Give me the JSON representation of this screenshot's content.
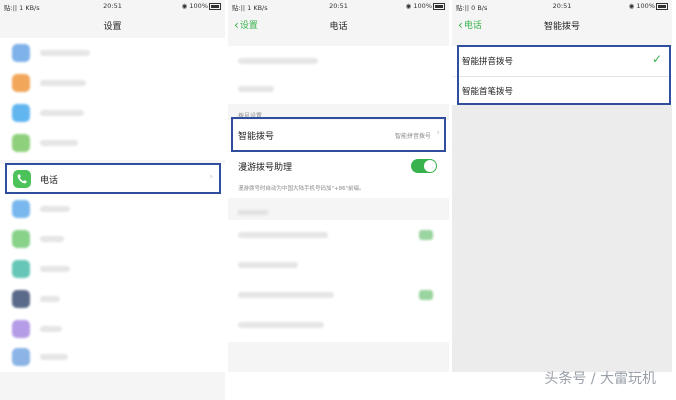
{
  "status_bar": {
    "panel1_left": "贴:|| 1 KB/s",
    "panel2_left": "贴:|| 1 KB/s",
    "panel3_left": "贴:|| 0 B/s",
    "time": "20:51",
    "battery": "100%"
  },
  "panel1": {
    "title": "设置",
    "highlighted_item": "电话",
    "highlight_color": "#2f4f9e"
  },
  "panel2": {
    "back_label": "设置",
    "title": "电话",
    "section_header": "拨号设置",
    "smart_dial_label": "智能拨号",
    "smart_dial_value": "智能拼音拨号",
    "roaming_label": "漫游拨号助理",
    "roaming_toggle_on": true,
    "roaming_desc": "漫游拨号时自动为中国大陆手机号码加\"+86\"前缀。",
    "accent_color": "#37b24d"
  },
  "panel3": {
    "back_label": "电话",
    "title": "智能拨号",
    "options": [
      {
        "label": "智能拼音拨号",
        "selected": true
      },
      {
        "label": "智能首笔拨号",
        "selected": false
      }
    ]
  },
  "watermark": "头条号 / 大雷玩机"
}
